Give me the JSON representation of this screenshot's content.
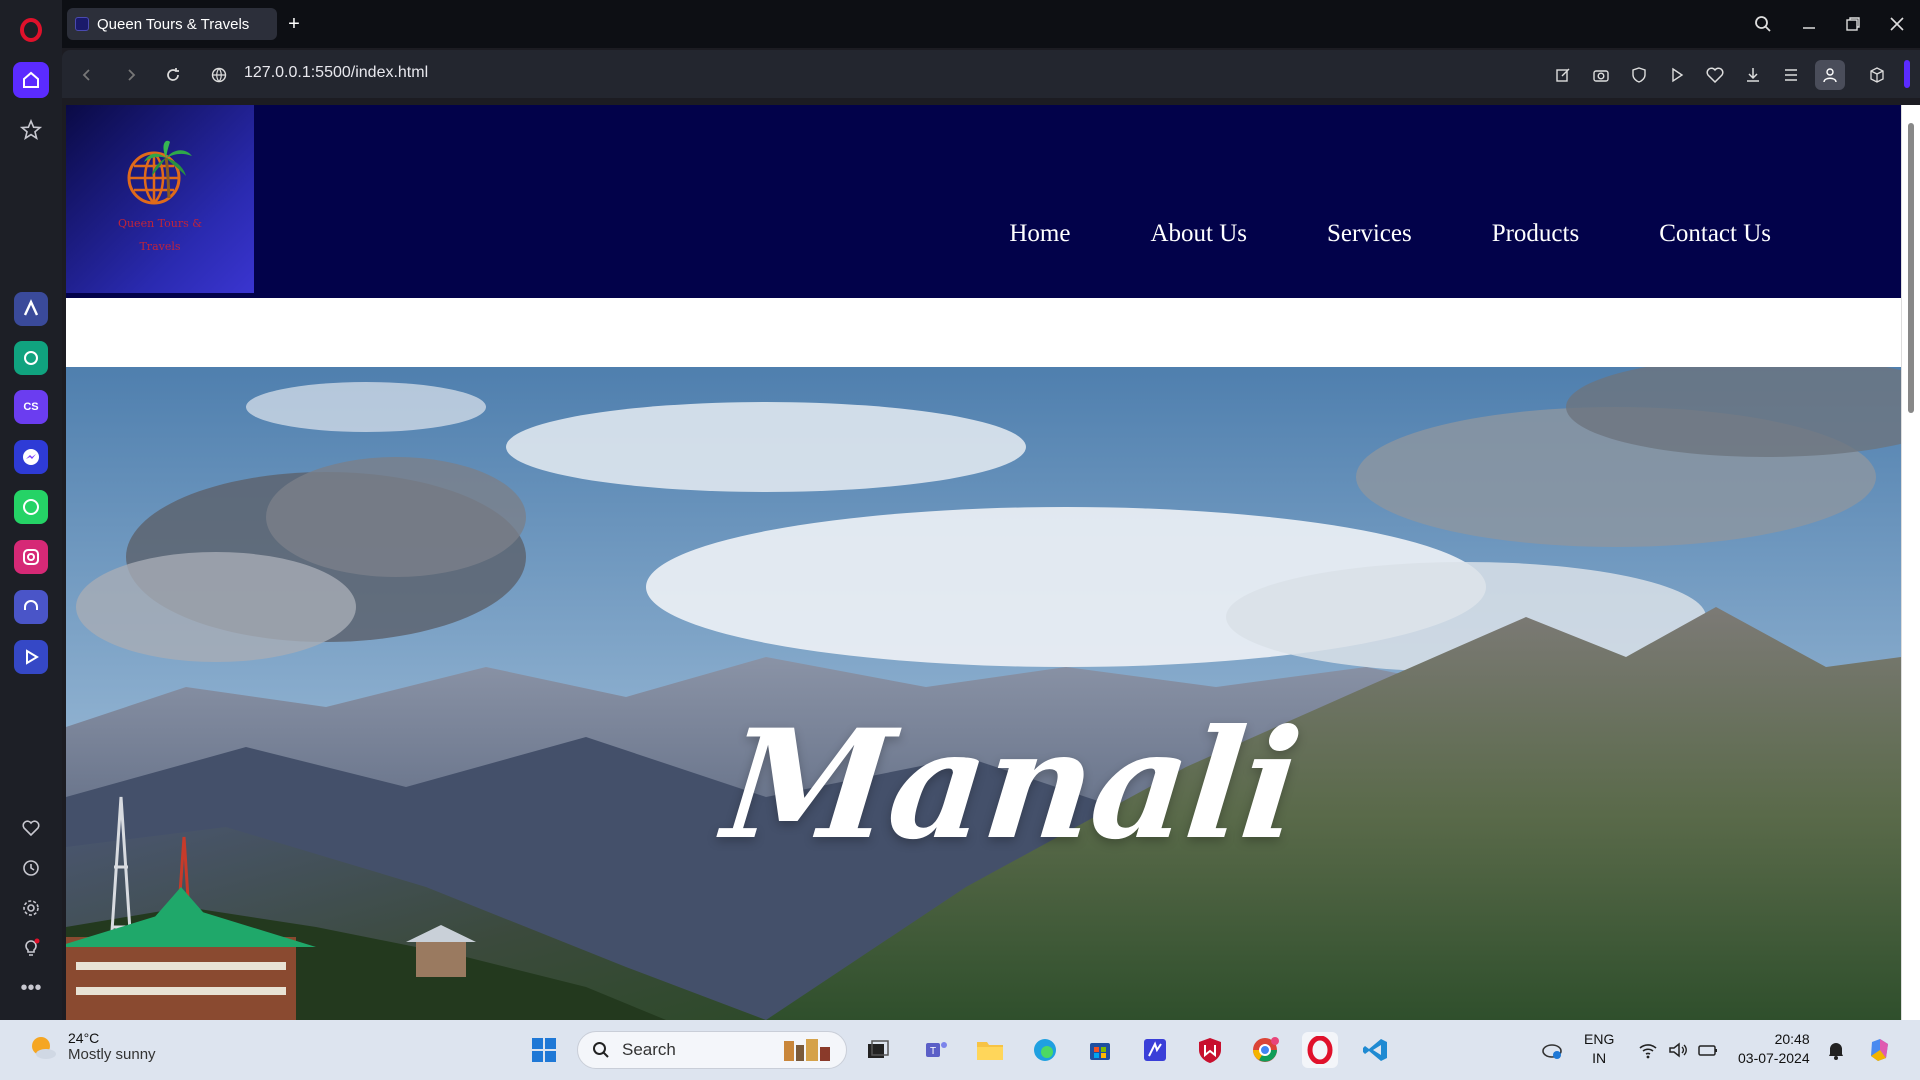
{
  "browser": {
    "tab_title": "Queen Tours & Travels",
    "url": "127.0.0.1:5500/index.html"
  },
  "site": {
    "logo_text": "Queen Tours & Travels",
    "nav": [
      "Home",
      "About Us",
      "Services",
      "Products",
      "Contact Us"
    ],
    "hero_title": "Manali"
  },
  "taskbar": {
    "weather_temp": "24°C",
    "weather_desc": "Mostly sunny",
    "search_label": "Search",
    "lang_top": "ENG",
    "lang_bottom": "IN",
    "time": "20:48",
    "date": "03-07-2024"
  },
  "colors": {
    "header_bg": "#02024a",
    "opera_red": "#e0112b",
    "sidebar_active": "#5b2bff"
  }
}
